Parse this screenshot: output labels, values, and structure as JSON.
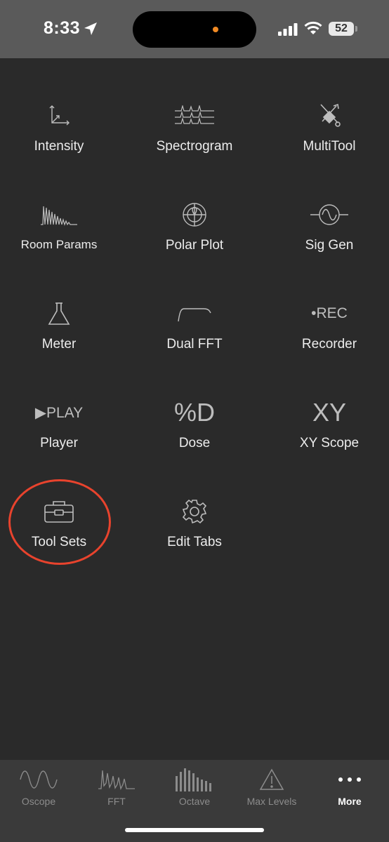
{
  "status_bar": {
    "time": "8:33",
    "battery": "52",
    "island_dot_color": "#f08a24"
  },
  "tools": [
    {
      "label": "Intensity",
      "icon": "axes-icon"
    },
    {
      "label": "Spectrogram",
      "icon": "spectrogram-icon"
    },
    {
      "label": "MultiTool",
      "icon": "multitool-icon"
    },
    {
      "label": "Room Params",
      "icon": "room-params-icon"
    },
    {
      "label": "Polar Plot",
      "icon": "polar-plot-icon"
    },
    {
      "label": "Sig Gen",
      "icon": "sine-wave-icon"
    },
    {
      "label": "Meter",
      "icon": "flask-icon"
    },
    {
      "label": "Dual FFT",
      "icon": "dual-fft-curve-icon"
    },
    {
      "label": "Recorder",
      "icon": "rec-icon",
      "icon_text": "•REC"
    },
    {
      "label": "Player",
      "icon": "play-icon",
      "icon_text": "▶PLAY"
    },
    {
      "label": "Dose",
      "icon": "dose-icon",
      "icon_text": "%D"
    },
    {
      "label": "XY Scope",
      "icon": "xy-icon",
      "icon_text": "XY"
    },
    {
      "label": "Tool Sets",
      "icon": "toolbox-icon"
    },
    {
      "label": "Edit Tabs",
      "icon": "gear-icon"
    }
  ],
  "highlight_color": "#e8432d",
  "tabs": [
    {
      "label": "Oscope",
      "icon": "oscope-icon"
    },
    {
      "label": "FFT",
      "icon": "fft-icon"
    },
    {
      "label": "Octave",
      "icon": "octave-icon"
    },
    {
      "label": "Max Levels",
      "icon": "warning-icon"
    },
    {
      "label": "More",
      "icon": "more-dots-icon",
      "active": true
    }
  ]
}
